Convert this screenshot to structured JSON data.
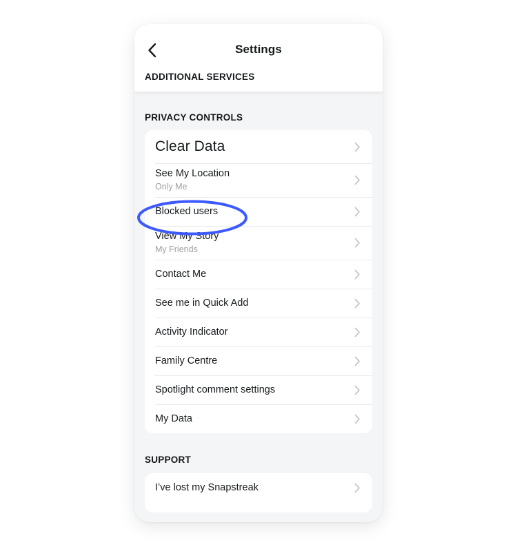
{
  "header": {
    "back_icon": "chevron-left-icon",
    "title": "Settings",
    "additional_services_label": "ADDITIONAL SERVICES"
  },
  "privacy_section": {
    "header": "PRIVACY CONTROLS",
    "rows": [
      {
        "title": "Clear Data",
        "subtitle": "",
        "chevron": "chevron-right-icon",
        "emphasized": true
      },
      {
        "title": "See My Location",
        "subtitle": "Only Me",
        "chevron": "chevron-right-icon"
      },
      {
        "title": "Blocked users",
        "subtitle": "",
        "chevron": "chevron-right-icon"
      },
      {
        "title": "View My Story",
        "subtitle": "My Friends",
        "chevron": "chevron-right-icon"
      },
      {
        "title": "Contact Me",
        "subtitle": "",
        "chevron": "chevron-right-icon"
      },
      {
        "title": "See me in Quick Add",
        "subtitle": "",
        "chevron": "chevron-right-icon"
      },
      {
        "title": "Activity Indicator",
        "subtitle": "",
        "chevron": "chevron-right-icon"
      },
      {
        "title": "Family Centre",
        "subtitle": "",
        "chevron": "chevron-right-icon"
      },
      {
        "title": "Spotlight comment settings",
        "subtitle": "",
        "chevron": "chevron-right-icon"
      },
      {
        "title": "My Data",
        "subtitle": "",
        "chevron": "chevron-right-icon"
      }
    ]
  },
  "support_section": {
    "header": "SUPPORT",
    "rows": [
      {
        "title": "I’ve lost my Snapstreak",
        "subtitle": "",
        "chevron": "chevron-right-icon"
      }
    ]
  },
  "annotation": {
    "target": "Clear Data",
    "shape": "ellipse",
    "color": "#3d5afe"
  },
  "colors": {
    "screen_background": "#f4f5f6",
    "card_background": "#ffffff",
    "text_primary": "#16191c",
    "text_secondary": "#9b9ea3",
    "chevron": "#c2c5c9",
    "divider": "#e9eaec",
    "annotation_blue": "#3d5afe"
  }
}
